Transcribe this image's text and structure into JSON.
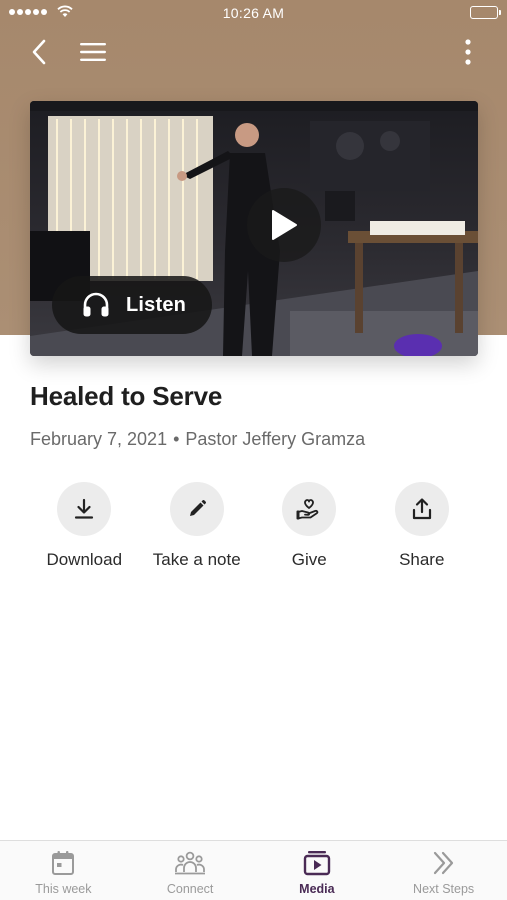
{
  "status_bar": {
    "time": "10:26 AM"
  },
  "nav": {
    "back_icon": "chevron-left-icon",
    "menu_icon": "hamburger-icon",
    "more_icon": "more-vertical-icon"
  },
  "hero": {
    "play_icon": "play-icon",
    "listen_label": "Listen",
    "listen_icon": "headphones-icon"
  },
  "sermon": {
    "title": "Healed to Serve",
    "date": "February 7, 2021",
    "separator": "•",
    "speaker": "Pastor Jeffery Gramza"
  },
  "actions": [
    {
      "label": "Download",
      "icon": "download-icon"
    },
    {
      "label": "Take a note",
      "icon": "pencil-icon"
    },
    {
      "label": "Give",
      "icon": "give-heart-hand-icon"
    },
    {
      "label": "Share",
      "icon": "share-icon"
    }
  ],
  "tabs": [
    {
      "label": "This week",
      "icon": "calendar-icon",
      "active": false
    },
    {
      "label": "Connect",
      "icon": "people-icon",
      "active": false
    },
    {
      "label": "Media",
      "icon": "media-icon",
      "active": true
    },
    {
      "label": "Next Steps",
      "icon": "chevrons-right-icon",
      "active": false
    }
  ],
  "colors": {
    "header_bg": "#a6886c",
    "active_tab": "#4a2b55",
    "inactive_tab": "#9a9a9a",
    "action_circle": "#ececec"
  }
}
